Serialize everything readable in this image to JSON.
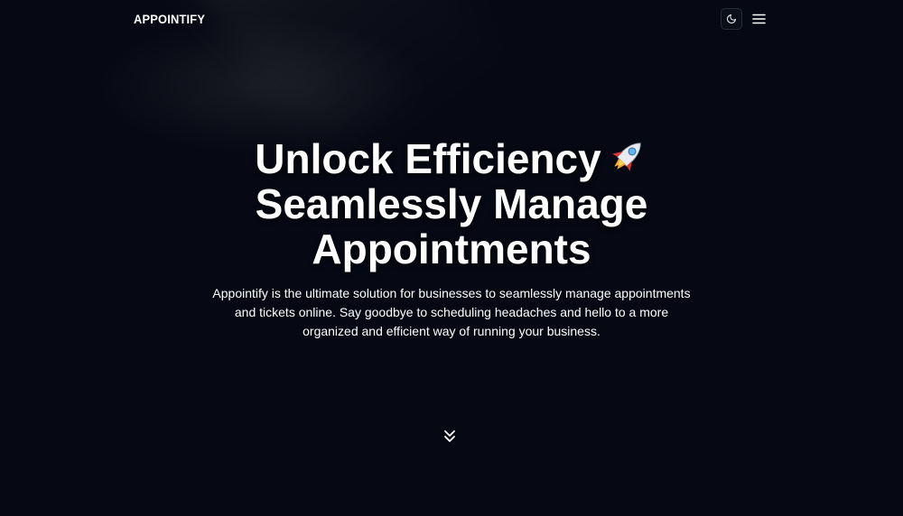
{
  "header": {
    "brand": "APPOINTIFY",
    "theme_toggle_icon": "moon-icon",
    "menu_icon": "hamburger-menu-icon"
  },
  "hero": {
    "title_line1": "Unlock Efficiency",
    "title_emoji_icon": "rocket-icon",
    "title_line2": "Seamlessly Manage",
    "title_line3": "Appointments",
    "description": "Appointify is the ultimate solution for businesses to seamlessly manage appointments and tickets online. Say goodbye to scheduling headaches and hello to a more organized and efficient way of running your business.",
    "scroll_icon": "double-chevron-down-icon"
  },
  "colors": {
    "background": "#060913",
    "text": "#ffffff",
    "button_border": "#262b37"
  }
}
